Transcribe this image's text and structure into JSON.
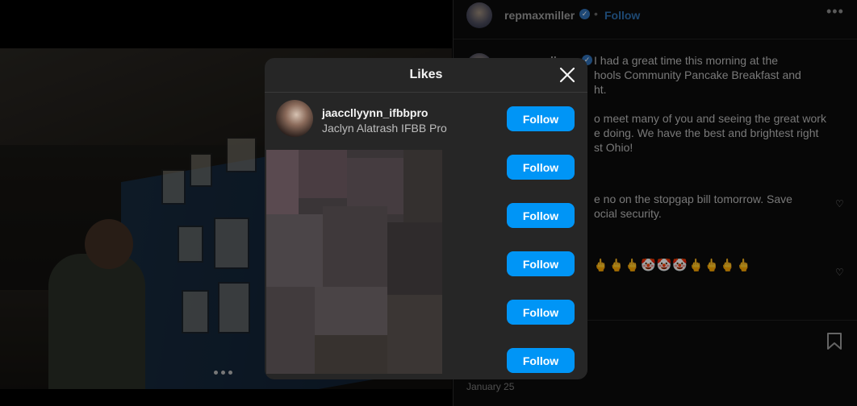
{
  "post": {
    "username": "repmaxmiller",
    "verified_mark": "✓",
    "bullet": "•",
    "follow_label": "Follow",
    "more_icon": "•••",
    "caption_lines": [
      "I had a great time this morning at the",
      "hools Community Pancake Breakfast and",
      "ht.",
      "o meet many of you and seeing the great work",
      "e doing. We have the best and brightest right",
      "st Ohio!",
      "e no on the stopgap bill tomorrow. Save",
      "ocial security."
    ],
    "comment_author_partial": "ller",
    "emoji_row": "🖕🖕🖕🤡🤡🤡🖕🖕🖕🖕",
    "date": "January 25"
  },
  "likes_modal": {
    "title": "Likes",
    "close_icon": "close-icon",
    "users": [
      {
        "username": "jaaccllyynn_ifbbpro",
        "full_name": "Jaclyn Alatrash IFBB Pro",
        "button": "Follow"
      },
      {
        "username": "",
        "full_name": "",
        "button": "Follow"
      },
      {
        "username": "",
        "full_name": "",
        "button": "Follow"
      },
      {
        "username": "",
        "full_name": "",
        "button": "Follow"
      },
      {
        "username": "",
        "full_name": "",
        "button": "Follow"
      },
      {
        "username": "",
        "full_name": "",
        "button": "Follow"
      }
    ]
  },
  "colors": {
    "accent": "#0095f6",
    "modal_bg": "#262626",
    "page_bg": "#000000"
  }
}
